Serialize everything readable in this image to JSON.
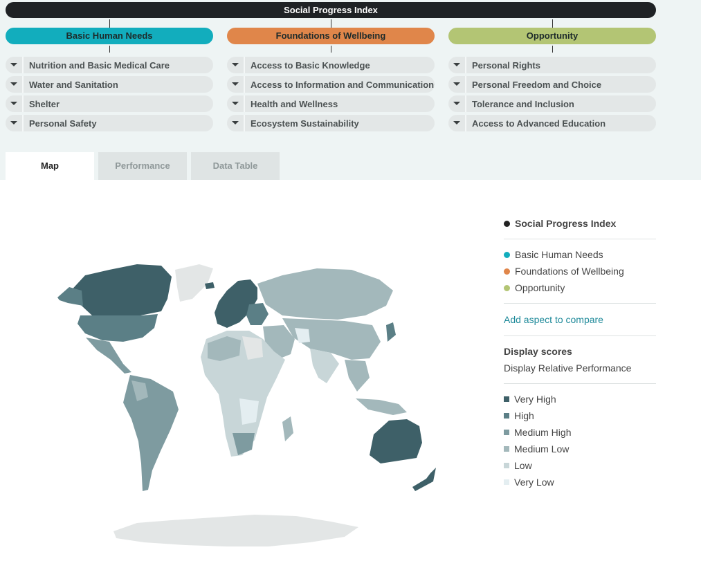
{
  "header": {
    "title": "Social Progress Index"
  },
  "dimensions": [
    {
      "label": "Basic Human Needs",
      "color": "#12adbd",
      "components": [
        "Nutrition and Basic Medical Care",
        "Water and Sanitation",
        "Shelter",
        "Personal Safety"
      ]
    },
    {
      "label": "Foundations of Wellbeing",
      "color": "#e0864a",
      "components": [
        "Access to Basic Knowledge",
        "Access to Information and Communications",
        "Health and Wellness",
        "Ecosystem Sustainability"
      ]
    },
    {
      "label": "Opportunity",
      "color": "#b3c574",
      "components": [
        "Personal Rights",
        "Personal Freedom and Choice",
        "Tolerance and Inclusion",
        "Access to Advanced Education"
      ]
    }
  ],
  "tabs": [
    {
      "label": "Map",
      "active": true
    },
    {
      "label": "Performance",
      "active": false
    },
    {
      "label": "Data Table",
      "active": false
    }
  ],
  "legend": {
    "index_label": "Social Progress Index",
    "index_color": "#222222",
    "aspects": [
      {
        "label": "Basic Human Needs",
        "color": "#12adbd"
      },
      {
        "label": "Foundations of Wellbeing",
        "color": "#e0864a"
      },
      {
        "label": "Opportunity",
        "color": "#b3c574"
      }
    ],
    "add_aspect_link": "Add aspect to compare",
    "display_scores_heading": "Display scores",
    "display_mode": "Display Relative Performance",
    "tiers": [
      {
        "label": "Very High",
        "color": "#3e6068"
      },
      {
        "label": "High",
        "color": "#5b7f86"
      },
      {
        "label": "Medium High",
        "color": "#7e9ba0"
      },
      {
        "label": "Medium Low",
        "color": "#a3b8bb"
      },
      {
        "label": "Low",
        "color": "#c8d6d8"
      },
      {
        "label": "Very Low",
        "color": "#e4eef1"
      }
    ]
  },
  "map": {
    "no_data_color": "#e3e6e6"
  }
}
